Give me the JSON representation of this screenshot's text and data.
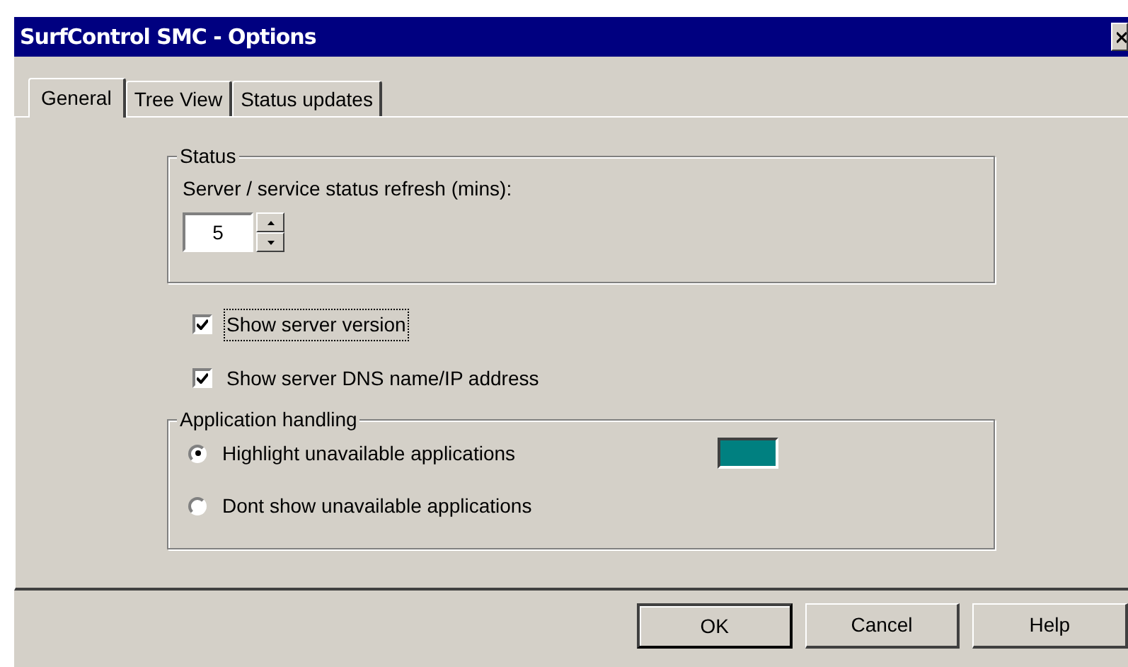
{
  "window": {
    "title": "SurfControl SMC - Options"
  },
  "tabs": [
    {
      "label": "General",
      "selected": true
    },
    {
      "label": "Tree View",
      "selected": false
    },
    {
      "label": "Status updates",
      "selected": false
    }
  ],
  "status_group": {
    "title": "Status",
    "label": "Server / service status refresh (mins):",
    "value": "5"
  },
  "checkboxes": [
    {
      "label": "Show server version",
      "checked": true,
      "focused": true
    },
    {
      "label": "Show server DNS name/IP address",
      "checked": true,
      "focused": false
    }
  ],
  "application_handling": {
    "title": "Application handling",
    "options": [
      {
        "label": "Highlight unavailable applications",
        "selected": true,
        "color": "#008080"
      },
      {
        "label": "Dont show unavailable applications",
        "selected": false
      }
    ]
  },
  "buttons": [
    {
      "label": "OK",
      "default": true
    },
    {
      "label": "Cancel",
      "default": false
    },
    {
      "label": "Help",
      "default": false
    }
  ]
}
